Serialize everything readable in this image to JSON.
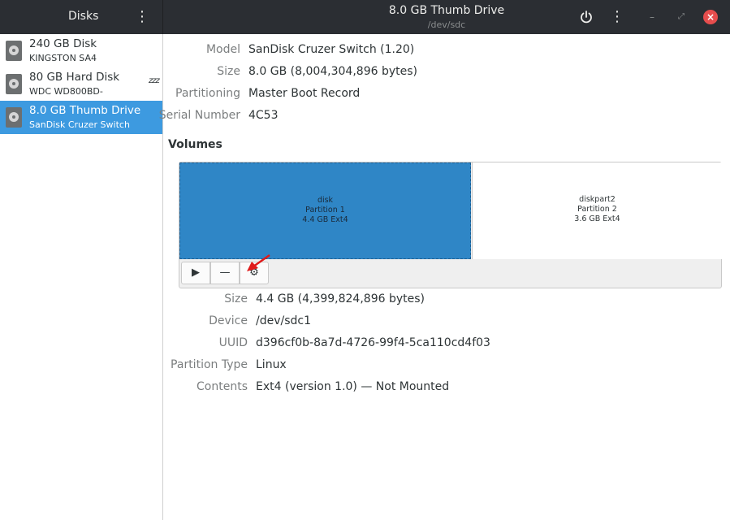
{
  "header": {
    "left_title": "Disks",
    "title": "8.0 GB Thumb Drive",
    "subtitle": "/dev/sdc"
  },
  "sidebar": {
    "items": [
      {
        "title": "240 GB Disk",
        "subtitle": "KINGSTON SA4",
        "selected": false,
        "sleeping": false
      },
      {
        "title": "80 GB Hard Disk",
        "subtitle": "WDC WD800BD-",
        "selected": false,
        "sleeping": true,
        "sleep_glyph": "zzz"
      },
      {
        "title": "8.0 GB Thumb Drive",
        "subtitle": "SanDisk Cruzer Switch",
        "selected": true,
        "sleeping": false
      }
    ]
  },
  "drive_info": {
    "model_label": "Model",
    "model_value": "SanDisk Cruzer Switch (1.20)",
    "size_label": "Size",
    "size_value": "8.0 GB (8,004,304,896 bytes)",
    "partitioning_label": "Partitioning",
    "partitioning_value": "Master Boot Record",
    "serial_label": "Serial Number",
    "serial_value": "4C53"
  },
  "volumes": {
    "section_title": "Volumes",
    "partitions": [
      {
        "name": "disk",
        "number": "Partition 1",
        "summary": "4.4 GB Ext4",
        "selected": true
      },
      {
        "name": "diskpart2",
        "number": "Partition 2",
        "summary": "3.6 GB Ext4",
        "selected": false
      }
    ],
    "toolbar": {
      "play_glyph": "▶",
      "minus_glyph": "—",
      "gear_glyph": "⚙"
    }
  },
  "partition_info": {
    "size_label": "Size",
    "size_value": "4.4 GB (4,399,824,896 bytes)",
    "device_label": "Device",
    "device_value": "/dev/sdc1",
    "uuid_label": "UUID",
    "uuid_value": "d396cf0b-8a7d-4726-99f4-5ca110cd4f03",
    "ptype_label": "Partition Type",
    "ptype_value": "Linux",
    "contents_label": "Contents",
    "contents_value": "Ext4 (version 1.0) — Not Mounted"
  },
  "colors": {
    "headerbar": "#2b2e33",
    "selection": "#3d9ae0",
    "partition_selected": "#2f86c6",
    "close_button": "#e64d4d",
    "annotation_arrow": "#e01b1b"
  }
}
